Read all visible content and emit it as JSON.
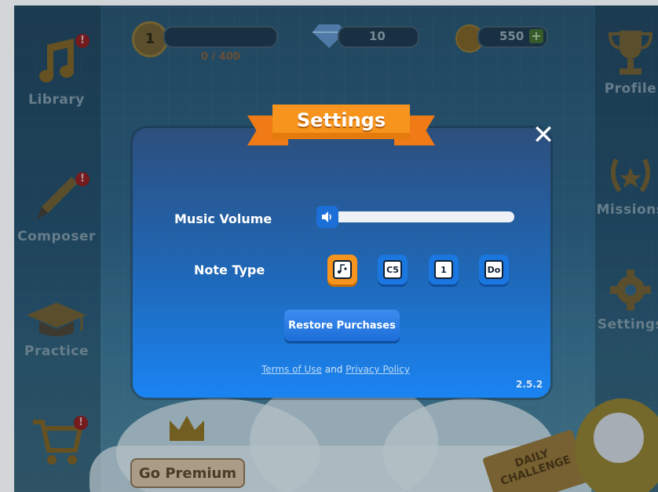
{
  "hud": {
    "level": "1",
    "xp": "0 / 400",
    "gems": "10",
    "coins": "550",
    "add_symbol": "+"
  },
  "sidebar_left": {
    "library": "Library",
    "composer": "Composer",
    "practice": "Practice",
    "badge_symbol": "!"
  },
  "sidebar_right": {
    "profile": "Profile",
    "missions": "Missions",
    "settings": "Settings"
  },
  "premium": {
    "label": "Go Premium"
  },
  "daily": {
    "line1": "DAILY",
    "line2": "CHALLENGE"
  },
  "settings_dialog": {
    "title": "Settings",
    "close_symbol": "✕",
    "music_volume_label": "Music Volume",
    "music_volume_level": 0.0,
    "note_type_label": "Note Type",
    "note_types": [
      "C5",
      "1",
      "Do"
    ],
    "selected_note_type": "note-icon",
    "restore_label": "Restore Purchases",
    "terms_label": "Terms of Use",
    "and_text": "and",
    "privacy_label": "Privacy Policy",
    "version": "2.5.2"
  },
  "colors": {
    "accent_orange": "#f7941d",
    "button_blue": "#1b77e0"
  }
}
